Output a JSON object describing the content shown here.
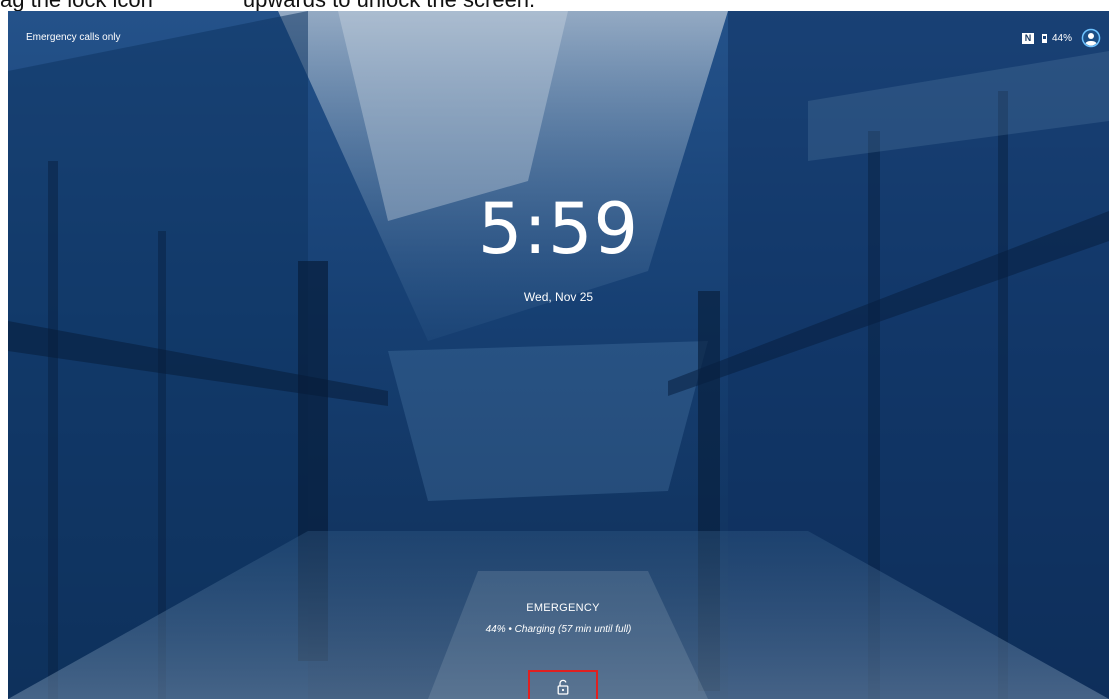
{
  "instruction": {
    "before": "ag the lock icon",
    "after": "upwards to unlock the screen."
  },
  "status_bar": {
    "carrier_text": "Emergency calls only",
    "nfc_label": "N",
    "battery_percent": "44%",
    "icons": [
      "nfc-icon",
      "battery-icon",
      "user-avatar-icon"
    ]
  },
  "lockscreen": {
    "time": "5:59",
    "date": "Wed, Nov 25",
    "emergency_label": "EMERGENCY",
    "charging_text": "44% • Charging (57 min until full)",
    "lock_icon": "lock-icon"
  },
  "colors": {
    "accent_highlight": "#e02020",
    "wallpaper_base": "#123a66",
    "text": "#ffffff"
  }
}
